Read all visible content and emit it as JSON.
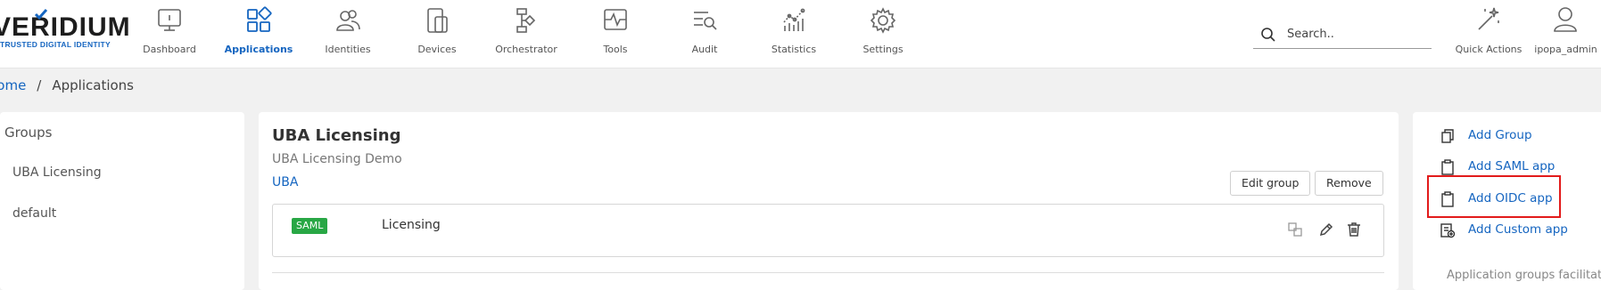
{
  "brand": {
    "name": "VERIDIUM",
    "tagline": "TRUSTED DIGITAL IDENTITY"
  },
  "nav": {
    "items": [
      {
        "label": "Dashboard",
        "icon": "monitor-icon",
        "active": false
      },
      {
        "label": "Applications",
        "icon": "apps-grid-icon",
        "active": true
      },
      {
        "label": "Identities",
        "icon": "identities-icon",
        "active": false
      },
      {
        "label": "Devices",
        "icon": "devices-icon",
        "active": false
      },
      {
        "label": "Orchestrator",
        "icon": "orchestrator-icon",
        "active": false
      },
      {
        "label": "Tools",
        "icon": "tools-icon",
        "active": false
      },
      {
        "label": "Audit",
        "icon": "audit-icon",
        "active": false
      },
      {
        "label": "Statistics",
        "icon": "statistics-icon",
        "active": false
      },
      {
        "label": "Settings",
        "icon": "gear-icon",
        "active": false
      }
    ]
  },
  "search": {
    "placeholder": "Search.."
  },
  "top_actions": {
    "quick_actions": "Quick Actions",
    "user": "ipopa_admin"
  },
  "breadcrumb": {
    "home": "Home",
    "current": "Applications"
  },
  "left": {
    "title": "Groups",
    "items": [
      "UBA Licensing",
      "default"
    ]
  },
  "group": {
    "title": "UBA Licensing",
    "description": "UBA Licensing Demo",
    "link": "UBA",
    "edit_label": "Edit group",
    "remove_label": "Remove"
  },
  "apps": [
    {
      "type": "SAML",
      "name": "Licensing"
    }
  ],
  "right": {
    "actions": [
      {
        "label": "Add Group",
        "icon": "copy-icon"
      },
      {
        "label": "Add SAML app",
        "icon": "clipboard-icon"
      },
      {
        "label": "Add OIDC app",
        "icon": "clipboard-icon"
      },
      {
        "label": "Add Custom app",
        "icon": "document-add-icon"
      }
    ],
    "info": "Application groups facilitate"
  },
  "colors": {
    "accent": "#1565c0",
    "badge": "#28a745",
    "highlight": "#e21b1b"
  }
}
